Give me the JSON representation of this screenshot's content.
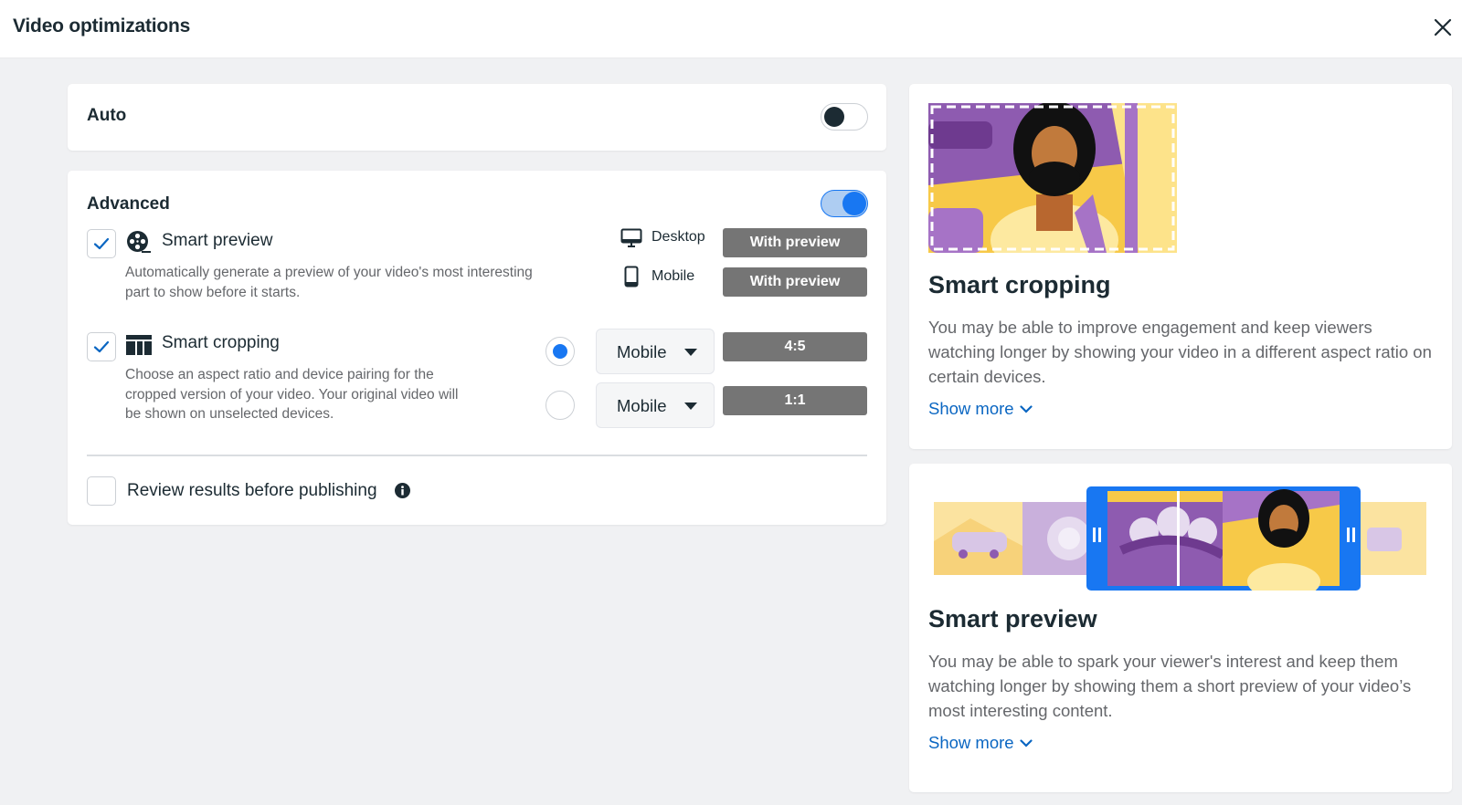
{
  "header": {
    "title": "Video optimizations",
    "close_icon": "close-icon"
  },
  "auto": {
    "label": "Auto",
    "toggle_on": false
  },
  "advanced": {
    "label": "Advanced",
    "toggle_on": true,
    "smart_preview": {
      "checked": true,
      "icon": "film-reel-icon",
      "label": "Smart preview",
      "description_line1": "Automatically generate a preview of your video's most interesting",
      "description_line2": "part to show before it starts.",
      "devices": [
        {
          "icon": "desktop-icon",
          "label": "Desktop",
          "value": "With preview"
        },
        {
          "icon": "mobile-icon",
          "label": "Mobile",
          "value": "With preview"
        }
      ]
    },
    "smart_cropping": {
      "checked": true,
      "icon": "crop-layout-icon",
      "label": "Smart cropping",
      "description_line1": "Choose an aspect ratio and device pairing for the",
      "description_line2": "cropped version of your video. Your original video will",
      "description_line3": "be shown on unselected devices.",
      "options": [
        {
          "selected": true,
          "device": "Mobile",
          "ratio": "4:5"
        },
        {
          "selected": false,
          "device": "Mobile",
          "ratio": "1:1"
        }
      ]
    },
    "review": {
      "checked": false,
      "label": "Review results before publishing",
      "info_icon": "info-icon"
    }
  },
  "info_cards": {
    "smart_cropping": {
      "title": "Smart cropping",
      "text": "You may be able to improve engagement and keep viewers watching longer by showing your video in a different aspect ratio on certain devices.",
      "show_more": "Show more"
    },
    "smart_preview": {
      "title": "Smart preview",
      "text": "You may be able to spark your viewer's interest and keep them watching longer by showing them a short preview of your video’s most interesting content.",
      "show_more": "Show more"
    }
  },
  "colors": {
    "accent": "#1877f2",
    "link": "#0a66c2",
    "grey_button": "#757575",
    "illustration_purple": "#8e5bb0",
    "illustration_yellow": "#f7c948"
  }
}
